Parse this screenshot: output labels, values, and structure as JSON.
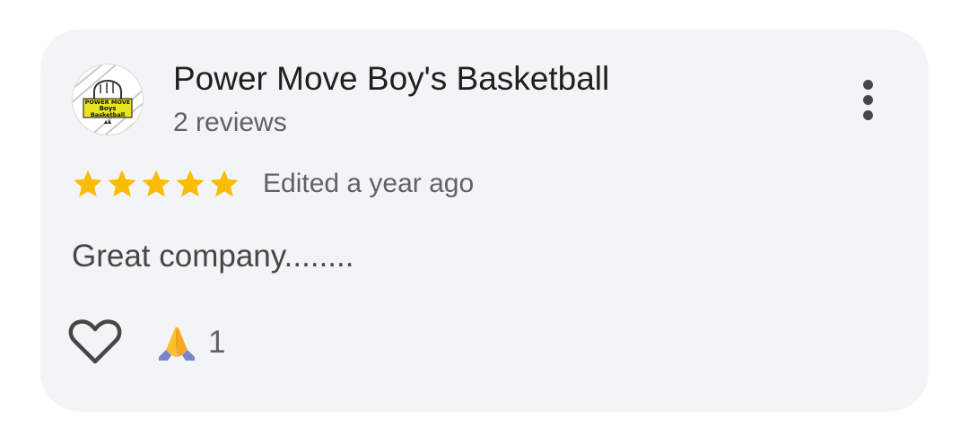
{
  "review": {
    "reviewer_name": "Power Move Boy's Basketball",
    "reviewer_reviews": "2 reviews",
    "rating": 5,
    "rating_max": 5,
    "edited_time": "Edited a year ago",
    "text": "Great company........",
    "reaction_count": "1"
  },
  "avatar": {
    "logo_line1": "POWER MOVE",
    "logo_line2": "Boys",
    "logo_line3": "Basketball"
  },
  "icons": {
    "more": "more-vert-icon",
    "star": "star-icon",
    "like": "heart-outline-icon",
    "reaction": "folded-hands-emoji"
  },
  "colors": {
    "card_background": "#f3f4f6",
    "star": "#fbbc04",
    "primary_text": "#1f1f1f",
    "secondary_text": "#5f6368",
    "logo_yellow": "#e6e61e"
  }
}
